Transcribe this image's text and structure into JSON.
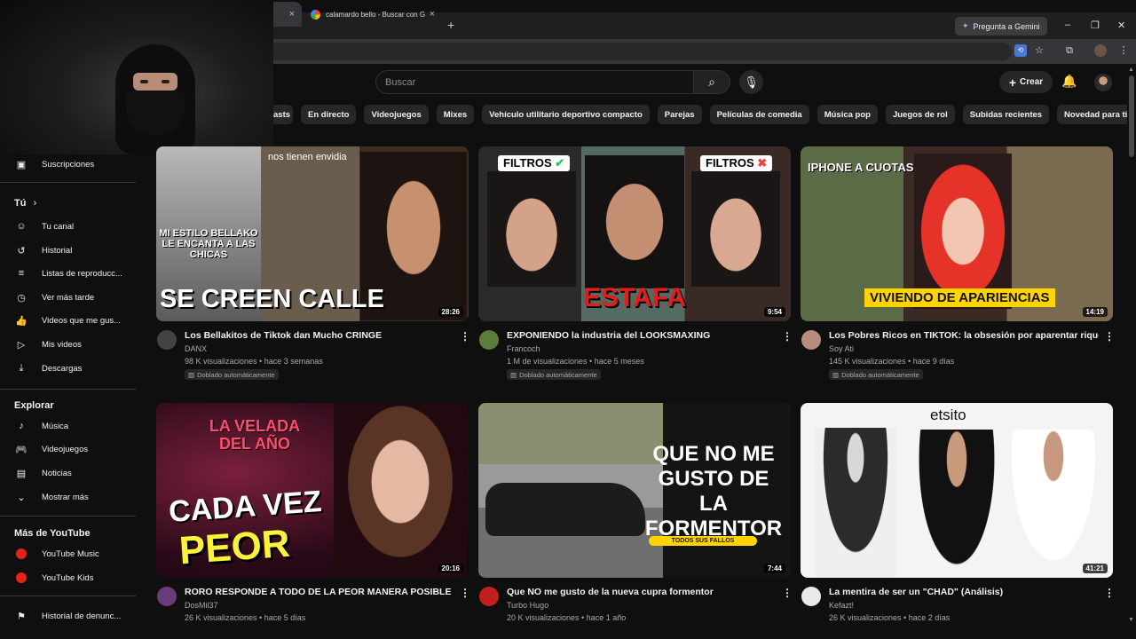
{
  "browser": {
    "tabs": [
      {
        "label": ""
      },
      {
        "label": "calamardo bello - Buscar con G"
      }
    ],
    "gemini_label": "Pregunta a Gemini",
    "new_tab": "+",
    "close": "×"
  },
  "header": {
    "search_placeholder": "Buscar",
    "create_label": "Crear"
  },
  "chips": [
    "asts",
    "En directo",
    "Videojuegos",
    "Mixes",
    "Vehículo utilitario deportivo compacto",
    "Parejas",
    "Películas de comedia",
    "Música pop",
    "Juegos de rol",
    "Subidas recientes",
    "Novedad para ti"
  ],
  "sidebar": {
    "subscriptions": "Suscripciones",
    "you_heading": "Tú",
    "you_items": [
      "Tu canal",
      "Historial",
      "Listas de reproducc...",
      "Ver más tarde",
      "Videos que me gus...",
      "Mis videos",
      "Descargas"
    ],
    "explore_heading": "Explorar",
    "explore_items": [
      "Música",
      "Videojuegos",
      "Noticias",
      "Mostrar más"
    ],
    "more_heading": "Más de YouTube",
    "more_items": [
      "YouTube Music",
      "YouTube Kids"
    ],
    "report_history": "Historial de denunc..."
  },
  "videos": [
    {
      "title": "Los Bellakitos de Tiktok dan Mucho CRINGE",
      "channel": "DANX",
      "meta": "98 K visualizaciones • hace 3 semanas",
      "dubbed": "Doblado automáticamente",
      "duration": "28:26",
      "thumb_top_text": "nos tienen envidia",
      "thumb_mid_text": "MI ESTILO BELLAKO LE ENCANTA A LAS CHICAS",
      "thumb_main_text": "SE CREEN CALLE"
    },
    {
      "title": "EXPONIENDO la industria del LOOKSMAXING",
      "channel": "Francoch",
      "meta": "1 M de visualizaciones • hace 5 meses",
      "dubbed": "Doblado automáticamente",
      "duration": "9:54",
      "thumb_left_tag": "FILTROS",
      "thumb_right_tag": "FILTROS",
      "thumb_main_text": "ESTAFA"
    },
    {
      "title": "Los Pobres Ricos en TIKTOK: la obsesión por aparentar riqueza",
      "channel": "Soy Ati",
      "meta": "145 K visualizaciones • hace 9 días",
      "dubbed": "Doblado automáticamente",
      "duration": "14:19",
      "thumb_top_text": "IPHONE A CUOTAS",
      "thumb_main_text": "VIVIENDO DE APARIENCIAS"
    },
    {
      "title": "RORO RESPONDE A TODO DE LA PEOR MANERA POSIBLE",
      "channel": "DosMil37",
      "meta": "26 K visualizaciones • hace 5 días",
      "duration": "20:16",
      "thumb_top_text": "LA VELADA DEL AÑO",
      "thumb_main_text": "CADA VEZ",
      "thumb_main_text2": "PEOR"
    },
    {
      "title": "Que NO me gusto de la nueva cupra formentor",
      "channel": "Turbo Hugo",
      "meta": "20 K visualizaciones • hace 1 año",
      "duration": "7:44",
      "thumb_main_text": "QUE NO ME GUSTO DE LA FORMENTOR",
      "thumb_sub_text": "TODOS SUS FALLOS"
    },
    {
      "title": "La mentira de ser un \"CHAD\" (Análisis)",
      "channel": "Kefazt!",
      "meta": "26 K visualizaciones • hace 2 días",
      "duration": "41:21",
      "thumb_top_text": "etsito"
    }
  ]
}
